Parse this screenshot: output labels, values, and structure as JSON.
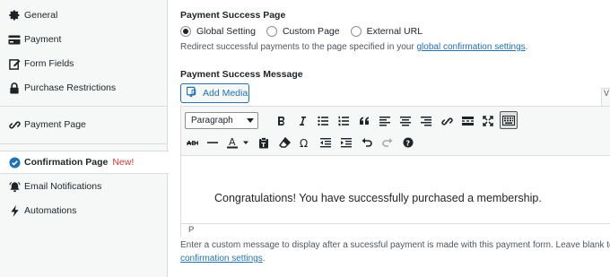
{
  "sidebar": {
    "items": [
      {
        "label": "General",
        "icon": "gear-icon"
      },
      {
        "label": "Payment",
        "icon": "credit-card-icon"
      },
      {
        "label": "Form Fields",
        "icon": "edit-icon"
      },
      {
        "label": "Purchase Restrictions",
        "icon": "lock-icon"
      },
      {
        "label": "Payment Page",
        "icon": "link-icon"
      },
      {
        "label": "Confirmation Page",
        "icon": "check-circle-icon",
        "badge": "New!"
      },
      {
        "label": "Email Notifications",
        "icon": "bell-icon"
      },
      {
        "label": "Automations",
        "icon": "lightning-icon"
      }
    ]
  },
  "main": {
    "success_page": {
      "heading": "Payment Success Page",
      "options": [
        "Global Setting",
        "Custom Page",
        "External URL"
      ],
      "selected": "Global Setting",
      "help_prefix": "Redirect successful payments to the page specified in your",
      "help_link": "global confirmation settings",
      "help_suffix": "."
    },
    "success_message": {
      "heading": "Payment Success Message",
      "add_media_label": "Add Media",
      "visual_tab": "V",
      "format_value": "Paragraph",
      "content": "Congratulations! You have successfully purchased a membership.",
      "path": "P",
      "help_line1": "Enter a custom message to display after a sucessful payment is made with this payment form. Leave blank to use",
      "help_link2": "confirmation settings",
      "help_suffix2": "."
    }
  },
  "colors": {
    "accent": "#2271b1",
    "new_badge": "#d63638",
    "active_icon": "#2271b1"
  }
}
